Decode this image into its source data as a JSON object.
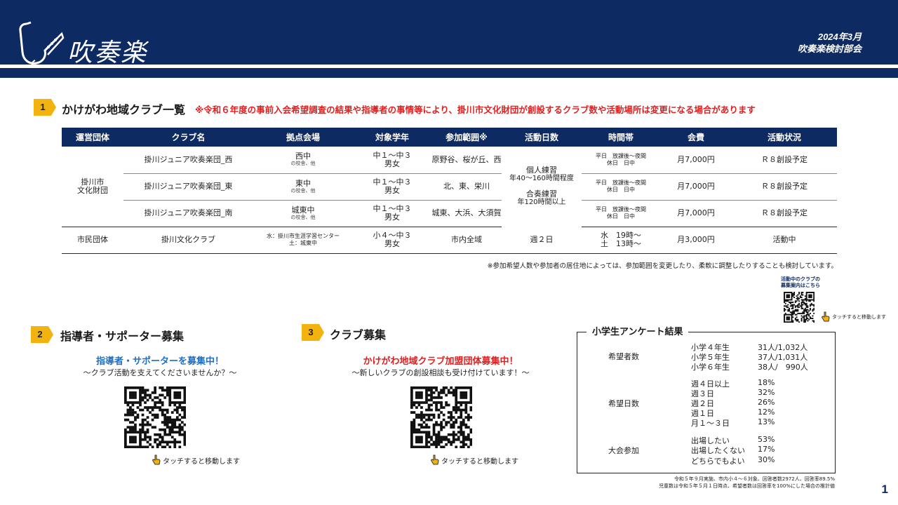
{
  "header": {
    "title": "吹奏楽",
    "date": "2024年3月",
    "committee": "吹奏楽検討部会",
    "logo_icon": "saxophone-icon"
  },
  "section1": {
    "number": "1",
    "title": "かけがわ地域クラブ一覧",
    "notice": "※令和６年度の事前入会希望調査の結果や指導者の事情等により、掛川市文化財団が創設するクラブ数や活動場所は変更になる場合があります",
    "columns": [
      "運営団体",
      "クラブ名",
      "拠点会場",
      "対象学年",
      "参加範囲※",
      "活動日数",
      "時間帯",
      "会費",
      "活動状況"
    ],
    "group1": {
      "org_line1": "掛川市",
      "org_line2": "文化財団",
      "days_line1": "個人練習",
      "days_line2": "年40～160時間程度",
      "days_line3": "合奏練習",
      "days_line4": "年120時間以上",
      "rows": [
        {
          "club": "掛川ジュニア吹奏楽団_西",
          "venue": "西中",
          "venue_sub": "の校舎、他",
          "grade1": "中１～中３",
          "grade2": "男女",
          "range": "原野谷、桜が丘、西",
          "time1": "平日　放課後～夜間",
          "time2": "休日　日中",
          "fee": "月7,000円",
          "status": "Ｒ８創設予定"
        },
        {
          "club": "掛川ジュニア吹奏楽団_東",
          "venue": "東中",
          "venue_sub": "の校舎、他",
          "grade1": "中１～中３",
          "grade2": "男女",
          "range": "北、東、栄川",
          "time1": "平日　放課後～夜間",
          "time2": "休日　日中",
          "fee": "月7,000円",
          "status": "Ｒ８創設予定"
        },
        {
          "club": "掛川ジュニア吹奏楽団_南",
          "venue": "城東中",
          "venue_sub": "の校舎、他",
          "grade1": "中１～中３",
          "grade2": "男女",
          "range": "城東、大浜、大須賀",
          "time1": "平日　放課後～夜間",
          "time2": "休日　日中",
          "fee": "月7,000円",
          "status": "Ｒ８創設予定"
        }
      ]
    },
    "row4": {
      "org": "市民団体",
      "club": "掛川文化クラブ",
      "venue1": "水：掛川市生涯学習センター",
      "venue2": "土：城東中",
      "grade1": "小４～中３",
      "grade2": "男女",
      "range": "市内全域",
      "days": "週２日",
      "time1": "水　19時～",
      "time2": "土　13時～",
      "fee": "月3,000円",
      "status": "活動中"
    },
    "table_note": "※参加希望人数や参加者の居住地によっては、参加範囲を変更したり、柔軟に調整したりすることも検討しています。",
    "qr_caption1": "活動中のクラブの",
    "qr_caption2": "募集案内はこちら",
    "touch_label": "タッチすると移動します"
  },
  "section2": {
    "number": "2",
    "title": "指導者・サポーター募集",
    "headline": "指導者・サポーターを募集中！",
    "subline": "～クラブ活動を支えてくださいませんか？～",
    "touch_label": "タッチすると移動します"
  },
  "section3": {
    "number": "3",
    "title": "クラブ募集",
    "headline": "かけがわ地域クラブ加盟団体募集中！",
    "subline": "～新しいクラブの創設相談も受け付けています！～",
    "touch_label": "タッチすると移動します"
  },
  "survey": {
    "title": "小学生アンケート結果",
    "applicants_label": "希望者数",
    "applicants": [
      {
        "k": "小学４年生",
        "v": "31人/1,032人"
      },
      {
        "k": "小学５年生",
        "v": "37人/1,031人"
      },
      {
        "k": "小学６年生",
        "v": "38人/　990人"
      }
    ],
    "days_label": "希望日数",
    "days": [
      {
        "k": "週４日以上",
        "v": "18%"
      },
      {
        "k": "週３日",
        "v": "32%"
      },
      {
        "k": "週２日",
        "v": "26%"
      },
      {
        "k": "週１日",
        "v": "12%"
      },
      {
        "k": "月１～３日",
        "v": "13%"
      }
    ],
    "contest_label": "大会参加",
    "contest": [
      {
        "k": "出場したい",
        "v": "53%"
      },
      {
        "k": "出場したくない",
        "v": "17%"
      },
      {
        "k": "どちらでもよい",
        "v": "30%"
      }
    ],
    "foot1": "令和５年９月実施、市内小４～６対象、回答者数2972人、回答率89.5%",
    "foot2": "児童数は令和５年５月１日時点、希望者数は回答率を100%にした場合の推計値"
  },
  "page_number": "1",
  "colors": {
    "navy": "#0e2a63",
    "badge": "#f2b20f",
    "red": "#e02020",
    "blue": "#1f6fc2"
  }
}
